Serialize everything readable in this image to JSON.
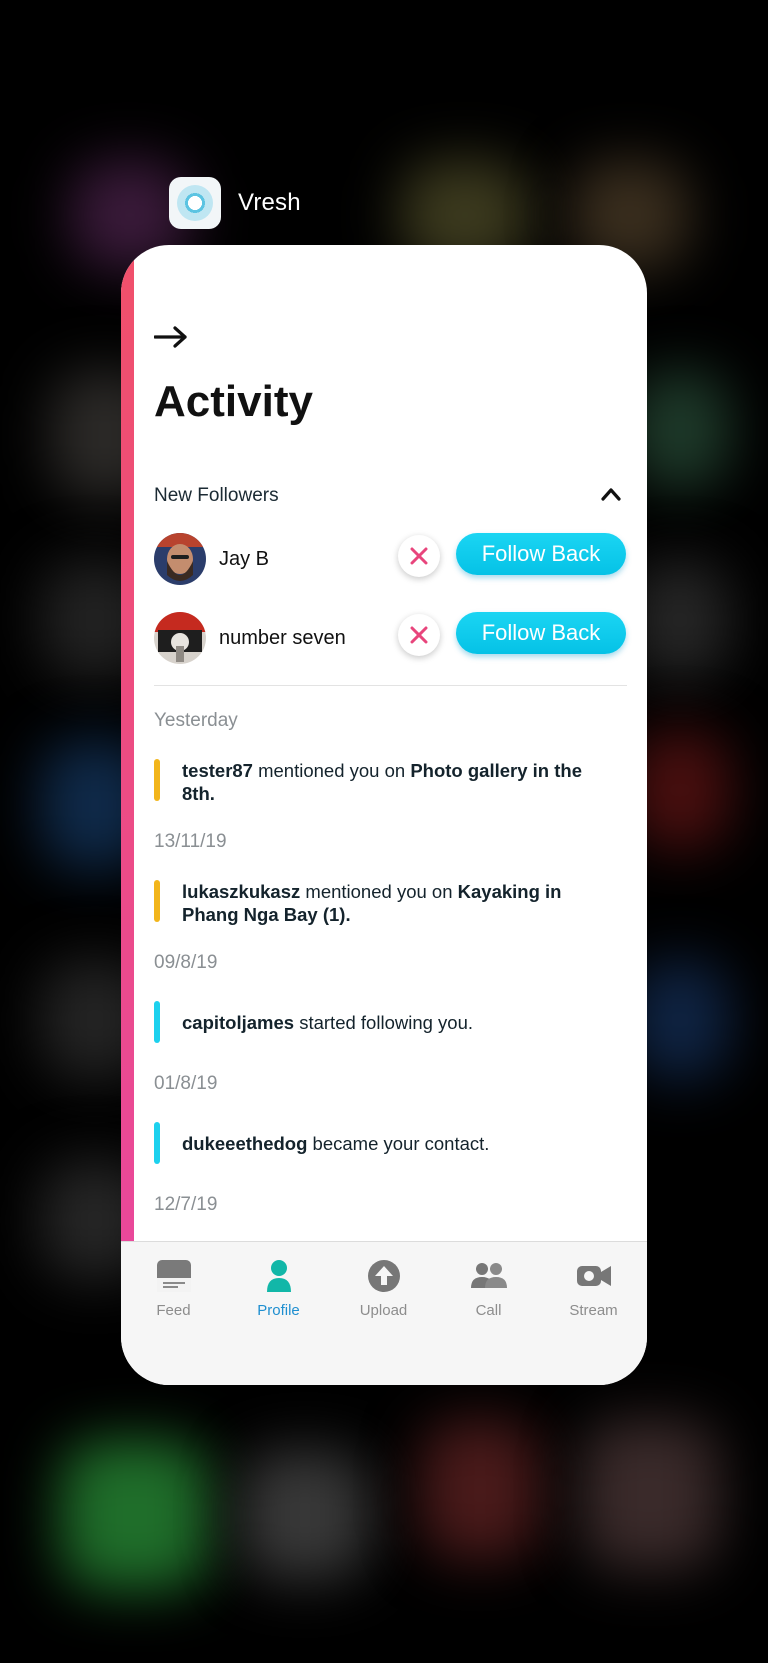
{
  "app": {
    "name": "Vresh"
  },
  "screen": {
    "title": "Activity"
  },
  "new_followers": {
    "label": "New Followers",
    "items": [
      {
        "name": "Jay B",
        "follow_label": "Follow Back"
      },
      {
        "name": "number seven",
        "follow_label": "Follow Back"
      }
    ]
  },
  "activity": [
    {
      "date": "Yesterday",
      "user": "tester87",
      "action": " mentioned you on ",
      "target": "Photo gallery in the 8th.",
      "type_color": "#f2b51b"
    },
    {
      "date": "13/11/19",
      "user": "lukaszkukasz",
      "action": " mentioned you on ",
      "target": "Kayaking in Phang Nga Bay (1).",
      "type_color": "#f2b51b"
    },
    {
      "date": "09/8/19",
      "user": "capitoljames",
      "action": " started following you.",
      "target": "",
      "type_color": "#1dd1ee"
    },
    {
      "date": "01/8/19",
      "user": "dukeeethedog",
      "action": " became your contact.",
      "target": "",
      "type_color": "#1dd1ee"
    },
    {
      "date": "12/7/19"
    }
  ],
  "tabs": [
    {
      "label": "Feed",
      "icon": "feed-icon"
    },
    {
      "label": "Profile",
      "icon": "profile-icon",
      "active": true
    },
    {
      "label": "Upload",
      "icon": "upload-icon"
    },
    {
      "label": "Call",
      "icon": "call-icon"
    },
    {
      "label": "Stream",
      "icon": "stream-icon"
    }
  ],
  "colors": {
    "accent_gradient_top": "#f0506a",
    "accent_gradient_bottom": "#e9489a",
    "follow_button": "#05c2e6",
    "dismiss_x": "#e8457c",
    "active_tab": "#1f8fd0"
  }
}
